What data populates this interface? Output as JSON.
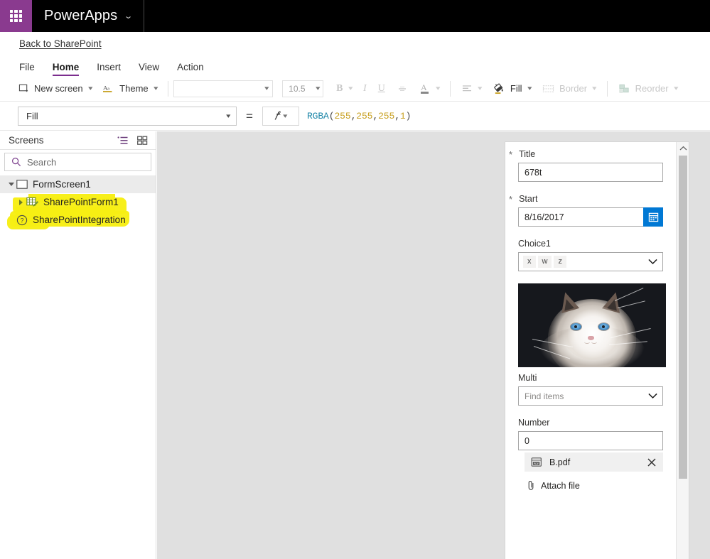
{
  "topbar": {
    "waffle_icon": "waffle-grid-icon",
    "brand": "PowerApps",
    "brand_caret": "⌄"
  },
  "backlink": {
    "label": "Back to SharePoint"
  },
  "menubar": {
    "items": [
      {
        "label": "File",
        "active": false
      },
      {
        "label": "Home",
        "active": true
      },
      {
        "label": "Insert",
        "active": false
      },
      {
        "label": "View",
        "active": false
      },
      {
        "label": "Action",
        "active": false
      }
    ]
  },
  "ribbon": {
    "new_screen": "New screen",
    "theme": "Theme",
    "font_family_value": "",
    "font_size_value": "10.5",
    "bold": "B",
    "italic": "I",
    "underline": "U",
    "strikethrough": "S",
    "font_color": "A",
    "align": "align-icon",
    "fill": "Fill",
    "border": "Border",
    "reorder": "Reorder"
  },
  "formula": {
    "property": "Fill",
    "equals": "=",
    "fx": "fx",
    "expression_fn": "RGBA",
    "expression_open": "(",
    "expression_args": [
      "255",
      "255",
      "255",
      "1"
    ],
    "expression_close": ")",
    "full_text": "RGBA(255,255,255,1)"
  },
  "sidebar": {
    "title": "Screens",
    "tree_view_icon": "tree-view-icon",
    "grid_view_icon": "grid-view-icon",
    "search_placeholder": "Search",
    "search_icon": "search-icon",
    "tree": [
      {
        "label": "FormScreen1",
        "icon": "screen-icon",
        "level": 0,
        "selected": true,
        "expanded": true,
        "highlighted": false
      },
      {
        "label": "SharePointForm1",
        "icon": "form-icon",
        "level": 1,
        "selected": false,
        "expanded": false,
        "highlighted": true
      },
      {
        "label": "SharePointIntegration",
        "icon": "question-icon",
        "level": 0,
        "selected": false,
        "expanded": null,
        "highlighted": true
      }
    ]
  },
  "form": {
    "fields": [
      {
        "name": "title",
        "label": "Title",
        "required": true,
        "type": "text",
        "value": "678t"
      },
      {
        "name": "start",
        "label": "Start",
        "required": true,
        "type": "date",
        "value": "8/16/2017",
        "button_icon": "calendar-icon"
      },
      {
        "name": "choice1",
        "label": "Choice1",
        "required": false,
        "type": "chips",
        "chips": [
          "x",
          "w",
          "z"
        ],
        "chevron_icon": "chevron-down-icon"
      },
      {
        "name": "image",
        "label": "",
        "required": false,
        "type": "image",
        "alt": "ragdoll-cat-photo"
      },
      {
        "name": "multi",
        "label": "Multi",
        "required": false,
        "type": "combo",
        "placeholder": "Find items",
        "chevron_icon": "chevron-down-icon"
      },
      {
        "name": "number",
        "label": "Number",
        "required": false,
        "type": "text",
        "value": "0"
      }
    ],
    "attachment": {
      "file_name": "B.pdf",
      "file_icon": "pdf-file-icon",
      "remove_icon": "close-icon",
      "add_label": "Attach file",
      "add_icon": "paperclip-icon"
    },
    "scrollbar": {
      "up_icon": "chevron-up-icon"
    }
  },
  "colors": {
    "brand_purple": "#8a3a8f",
    "accent_purple": "#7b2d8e",
    "topbar_black": "#000000",
    "canvas_gray": "#e0e0e0",
    "date_button_blue": "#0078d4",
    "highlighter_yellow": "#f7ee14",
    "formula_fn": "#1c86a8",
    "formula_num": "#c8a020"
  }
}
